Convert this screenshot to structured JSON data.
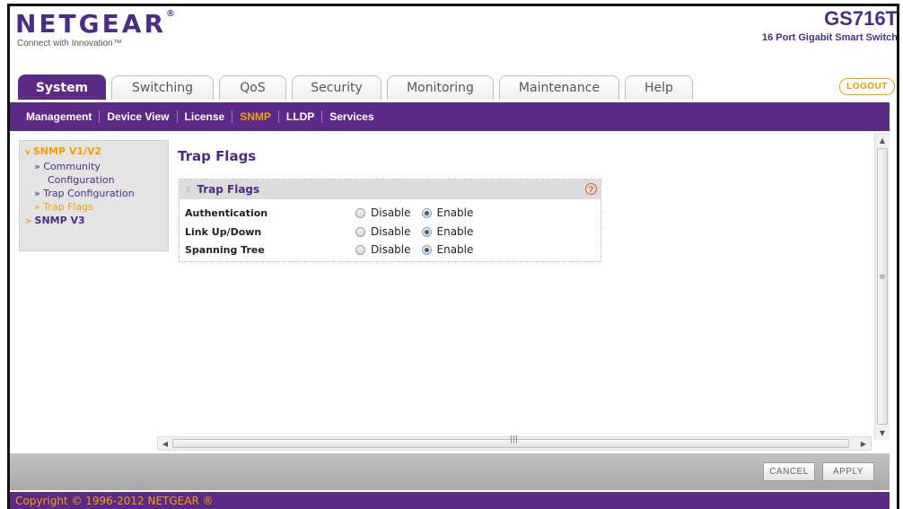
{
  "brand": {
    "logo": "NETGEAR",
    "logo_mark": "®",
    "tagline": "Connect with Innovation™",
    "product_name": "GS716T",
    "product_desc": "16 Port Gigabit Smart Switch"
  },
  "tabs": [
    {
      "label": "System",
      "active": true
    },
    {
      "label": "Switching",
      "active": false
    },
    {
      "label": "QoS",
      "active": false
    },
    {
      "label": "Security",
      "active": false
    },
    {
      "label": "Monitoring",
      "active": false
    },
    {
      "label": "Maintenance",
      "active": false
    },
    {
      "label": "Help",
      "active": false
    }
  ],
  "logout_label": "LOGOUT",
  "subnav": [
    {
      "label": "Management",
      "active": false
    },
    {
      "label": "Device View",
      "active": false
    },
    {
      "label": "License",
      "active": false
    },
    {
      "label": "SNMP",
      "active": true
    },
    {
      "label": "LLDP",
      "active": false
    },
    {
      "label": "Services",
      "active": false
    }
  ],
  "leftnav": {
    "group1": "SNMP V1/V2",
    "group1_chevron": "v",
    "items": [
      {
        "label": "» Community",
        "active": false
      },
      {
        "label": "Configuration",
        "active": false
      },
      {
        "label": "» Trap Configuration",
        "active": false
      },
      {
        "label": "» Trap Flags",
        "active": true
      }
    ],
    "group2": "SNMP V3",
    "group2_chevron": ">"
  },
  "page_title": "Trap Flags",
  "panel": {
    "title": "Trap Flags",
    "help": "?",
    "rows": [
      {
        "label": "Authentication",
        "disable": "Disable",
        "enable": "Enable",
        "selected": "Enable"
      },
      {
        "label": "Link Up/Down",
        "disable": "Disable",
        "enable": "Enable",
        "selected": "Enable"
      },
      {
        "label": "Spanning Tree",
        "disable": "Disable",
        "enable": "Enable",
        "selected": "Enable"
      }
    ]
  },
  "buttons": {
    "cancel": "CANCEL",
    "apply": "APPLY"
  },
  "footer": "Copyright © 1996-2012 NETGEAR ®",
  "colors": {
    "brand_purple": "#5b2a86",
    "accent_orange": "#f2a000"
  }
}
